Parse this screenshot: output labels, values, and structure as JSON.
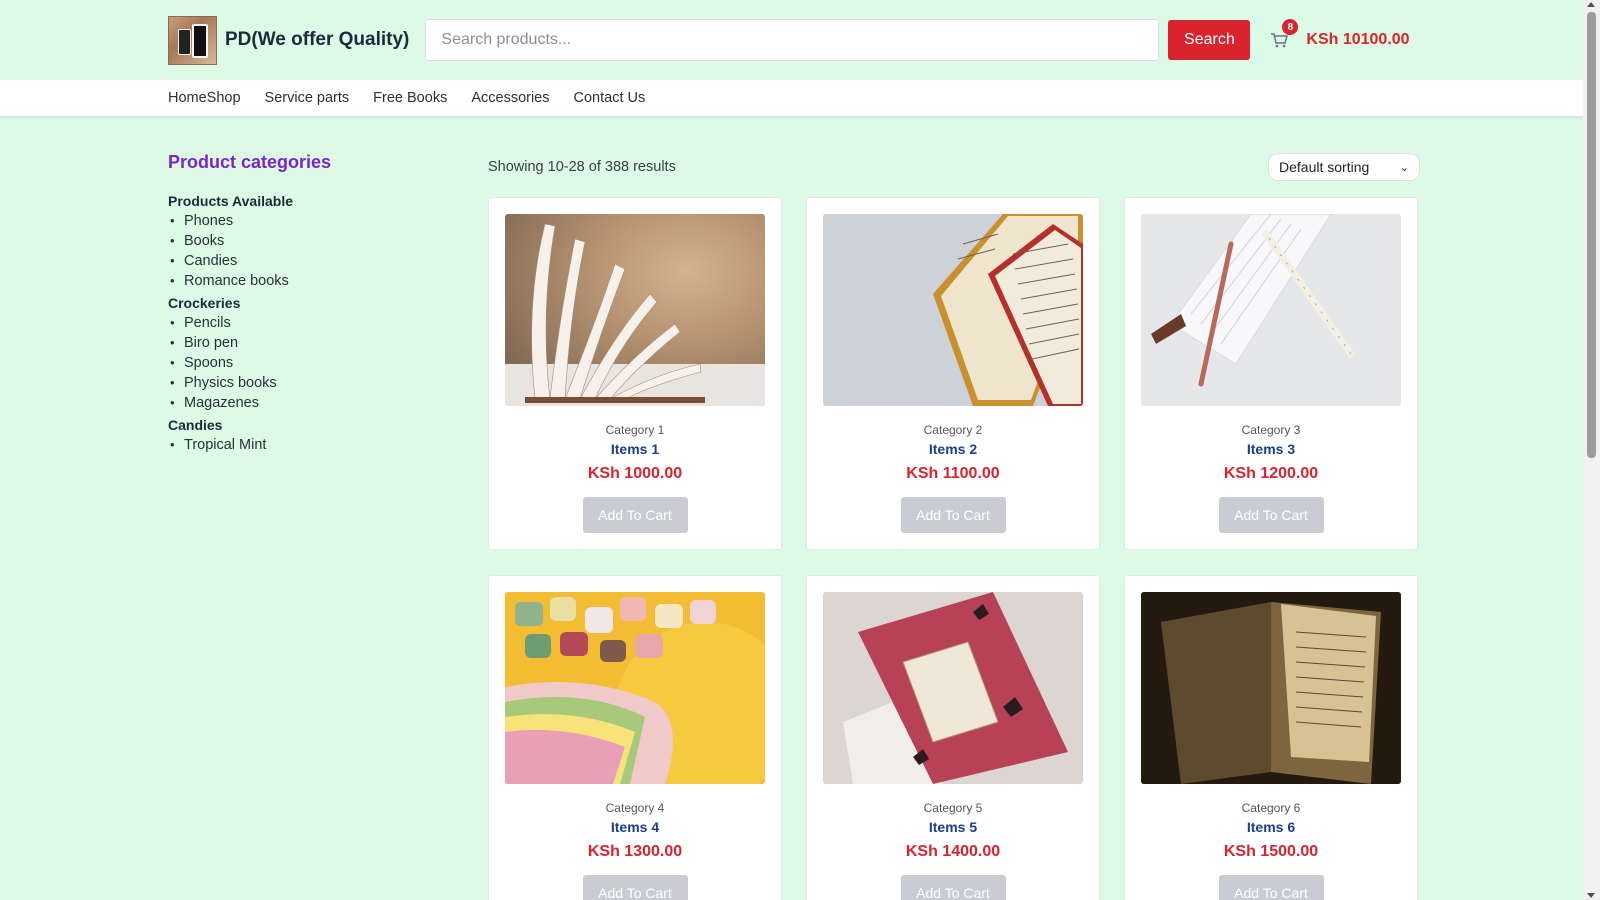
{
  "header": {
    "brand": "PD(We offer Quality)",
    "search_placeholder": "Search products...",
    "search_label": "Search",
    "cart_count": "8",
    "cart_total": "KSh 10100.00"
  },
  "nav": [
    "HomeShop",
    "Service parts",
    "Free Books",
    "Accessories",
    "Contact Us"
  ],
  "sidebar": {
    "title": "Product categories",
    "groups": [
      {
        "title": "Products Available",
        "items": [
          "Phones",
          "Books",
          "Candies",
          "Romance books"
        ]
      },
      {
        "title": "Crockeries",
        "items": [
          "Pencils",
          "Biro pen",
          "Spoons",
          "Physics books",
          "Magazenes"
        ]
      },
      {
        "title": "Candies",
        "items": [
          "Tropical Mint"
        ]
      }
    ]
  },
  "listing": {
    "results_text": "Showing 10-28 of 388 results",
    "sort_value": "Default sorting"
  },
  "products": [
    {
      "category": "Category 1",
      "name": "Items 1",
      "price": "KSh 1000.00",
      "button": "Add To Cart"
    },
    {
      "category": "Category 2",
      "name": "Items 2",
      "price": "KSh 1100.00",
      "button": "Add To Cart"
    },
    {
      "category": "Category 3",
      "name": "Items 3",
      "price": "KSh 1200.00",
      "button": "Add To Cart"
    },
    {
      "category": "Category 4",
      "name": "Items 4",
      "price": "KSh 1300.00",
      "button": "Add To Cart"
    },
    {
      "category": "Category 5",
      "name": "Items 5",
      "price": "KSh 1400.00",
      "button": "Add To Cart"
    },
    {
      "category": "Category 6",
      "name": "Items 6",
      "price": "KSh 1500.00",
      "button": "Add To Cart"
    }
  ],
  "colors": {
    "background": "#dcfae6",
    "accent_red": "#d9232d",
    "category_title": "#7b25c8",
    "item_name": "#1b3d8a"
  },
  "icons": {
    "cart": "cart-icon",
    "sort": "chevron-down-icon"
  }
}
